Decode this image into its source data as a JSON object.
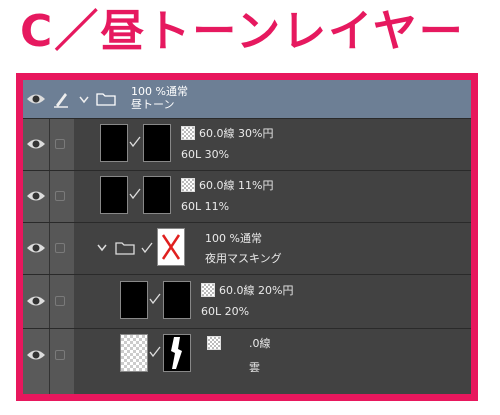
{
  "heading": "C／昼トーンレイヤー",
  "layers": [
    {
      "line1": "100 %通常",
      "line2": "昼トーン"
    },
    {
      "line1": "60.0線 30%円",
      "line2": "60L 30%"
    },
    {
      "line1": "60.0線 11%円",
      "line2": "60L 11%"
    },
    {
      "line1": "100 %通常",
      "line2": "夜用マスキング"
    },
    {
      "line1": "60.0線 20%円",
      "line2": "60L 20%"
    },
    {
      "line1": ".0線",
      "line2": "雲"
    }
  ],
  "colors": {
    "accent": "#e8175d",
    "selected_row": "#6d7f95",
    "panel": "#424242"
  }
}
